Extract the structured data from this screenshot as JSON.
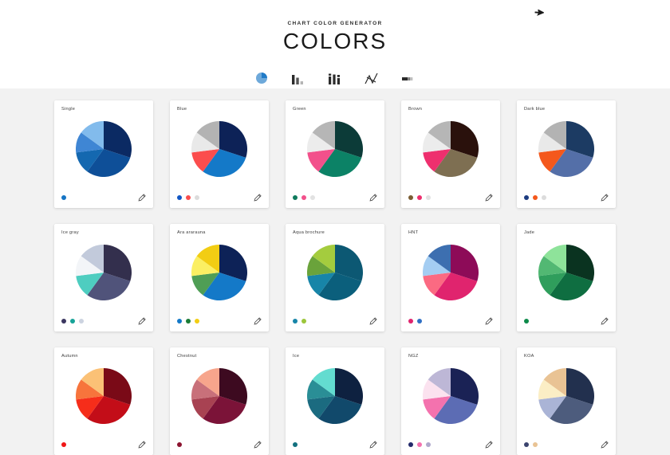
{
  "header": {
    "kicker": "CHART COLOR GENERATOR",
    "wordmark": "COLORS"
  },
  "toolbar": {
    "items": [
      {
        "name": "pie-chart",
        "label": "Pie chart",
        "active": true
      },
      {
        "name": "bar-chart",
        "label": "Bar chart",
        "active": false
      },
      {
        "name": "column-chart",
        "label": "Column chart",
        "active": false
      },
      {
        "name": "line-chart",
        "label": "Line chart",
        "active": false
      },
      {
        "name": "stacked-bar-chart",
        "label": "Stacked bar chart",
        "active": false
      }
    ],
    "active_color": "#1574c4",
    "inactive_color": "#2b2b2b"
  },
  "card_actions": {
    "edit_label": "Edit palette",
    "edit_icon": "pencil-icon"
  },
  "chart_data": {
    "type": "pie",
    "title": "Chart color generator palettes",
    "slice_proportions": [
      30,
      30,
      13,
      12,
      15
    ],
    "slice_order": "clockwise from 12 o'clock",
    "legend": "none",
    "grid": false,
    "palettes": [
      {
        "name": "Single",
        "colors": [
          "#0b2a63",
          "#0e4f98",
          "#1468b0",
          "#3f86d4",
          "#82bbec"
        ],
        "swatches": [
          "#1574c4"
        ]
      },
      {
        "name": "Blue",
        "colors": [
          "#0d2257",
          "#1479c8",
          "#fb4d4d",
          "#e9e9e9",
          "#b3b3b3"
        ],
        "swatches": [
          "#1157c4",
          "#fb4d4d",
          "#dcdcdc"
        ]
      },
      {
        "name": "Green",
        "colors": [
          "#0c3b38",
          "#0c8266",
          "#f2508b",
          "#ececec",
          "#b6b6b6"
        ],
        "swatches": [
          "#0f7a5c",
          "#f2508b",
          "#e2e2e2"
        ]
      },
      {
        "name": "Brown",
        "colors": [
          "#2a110c",
          "#7e6f52",
          "#ee2f6e",
          "#ececec",
          "#b6b6b6"
        ],
        "swatches": [
          "#7a5d33",
          "#ee2f6e",
          "#e2e2e2"
        ]
      },
      {
        "name": "Dark blue",
        "colors": [
          "#1c3b63",
          "#546fa8",
          "#f4581c",
          "#e9e9e9",
          "#b3b3b3"
        ],
        "swatches": [
          "#1c3b80",
          "#f4581c",
          "#dcdcdc"
        ]
      },
      {
        "name": "Ice gray",
        "colors": [
          "#332f4d",
          "#50537a",
          "#4ecdc0",
          "#f3f5f8",
          "#c2cadb"
        ],
        "swatches": [
          "#3b3760",
          "#17a398",
          "#ccd3e0"
        ]
      },
      {
        "name": "Ara ararauna",
        "colors": [
          "#0d2257",
          "#1479c8",
          "#4f9e55",
          "#fbef63",
          "#f2cd13"
        ],
        "swatches": [
          "#1479c8",
          "#1a7c36",
          "#f2cd13"
        ]
      },
      {
        "name": "Aqua brochure",
        "colors": [
          "#0c5873",
          "#0b5f7c",
          "#1785a8",
          "#6aa33b",
          "#a4cc3e"
        ],
        "swatches": [
          "#1785a8",
          "#9cc63b"
        ]
      },
      {
        "name": "HNT",
        "colors": [
          "#8d0b58",
          "#e0246e",
          "#fb6a82",
          "#a4cdf2",
          "#3d6fb0"
        ],
        "swatches": [
          "#e0246e",
          "#2f6fc4"
        ]
      },
      {
        "name": "Jade",
        "colors": [
          "#0a3320",
          "#0f6e41",
          "#2f9e5c",
          "#52b873",
          "#8ee39a"
        ],
        "swatches": [
          "#0d8a4a"
        ]
      },
      {
        "name": "Autumn",
        "colors": [
          "#7a0a17",
          "#c30d18",
          "#f62d1a",
          "#f7743c",
          "#fbc176"
        ],
        "swatches": [
          "#f01616"
        ]
      },
      {
        "name": "Chestnut",
        "colors": [
          "#3d0a20",
          "#7b1338",
          "#a84252",
          "#c8707a",
          "#f7a58c"
        ],
        "swatches": [
          "#8c1430"
        ]
      },
      {
        "name": "Ice",
        "colors": [
          "#0e2140",
          "#11496b",
          "#1b6b80",
          "#2a8e96",
          "#63dcd0"
        ],
        "swatches": [
          "#12707f"
        ]
      },
      {
        "name": "NGZ",
        "colors": [
          "#1a2255",
          "#5c6cb4",
          "#f472ae",
          "#fbe2ef",
          "#bdb7d6"
        ],
        "swatches": [
          "#232a6b",
          "#f472ae",
          "#b0a9cc"
        ]
      },
      {
        "name": "KOA",
        "colors": [
          "#22304e",
          "#4d5c7d",
          "#aab4d6",
          "#fbeec5",
          "#e9c394"
        ],
        "swatches": [
          "#3b446e",
          "#e9c394"
        ]
      }
    ]
  }
}
